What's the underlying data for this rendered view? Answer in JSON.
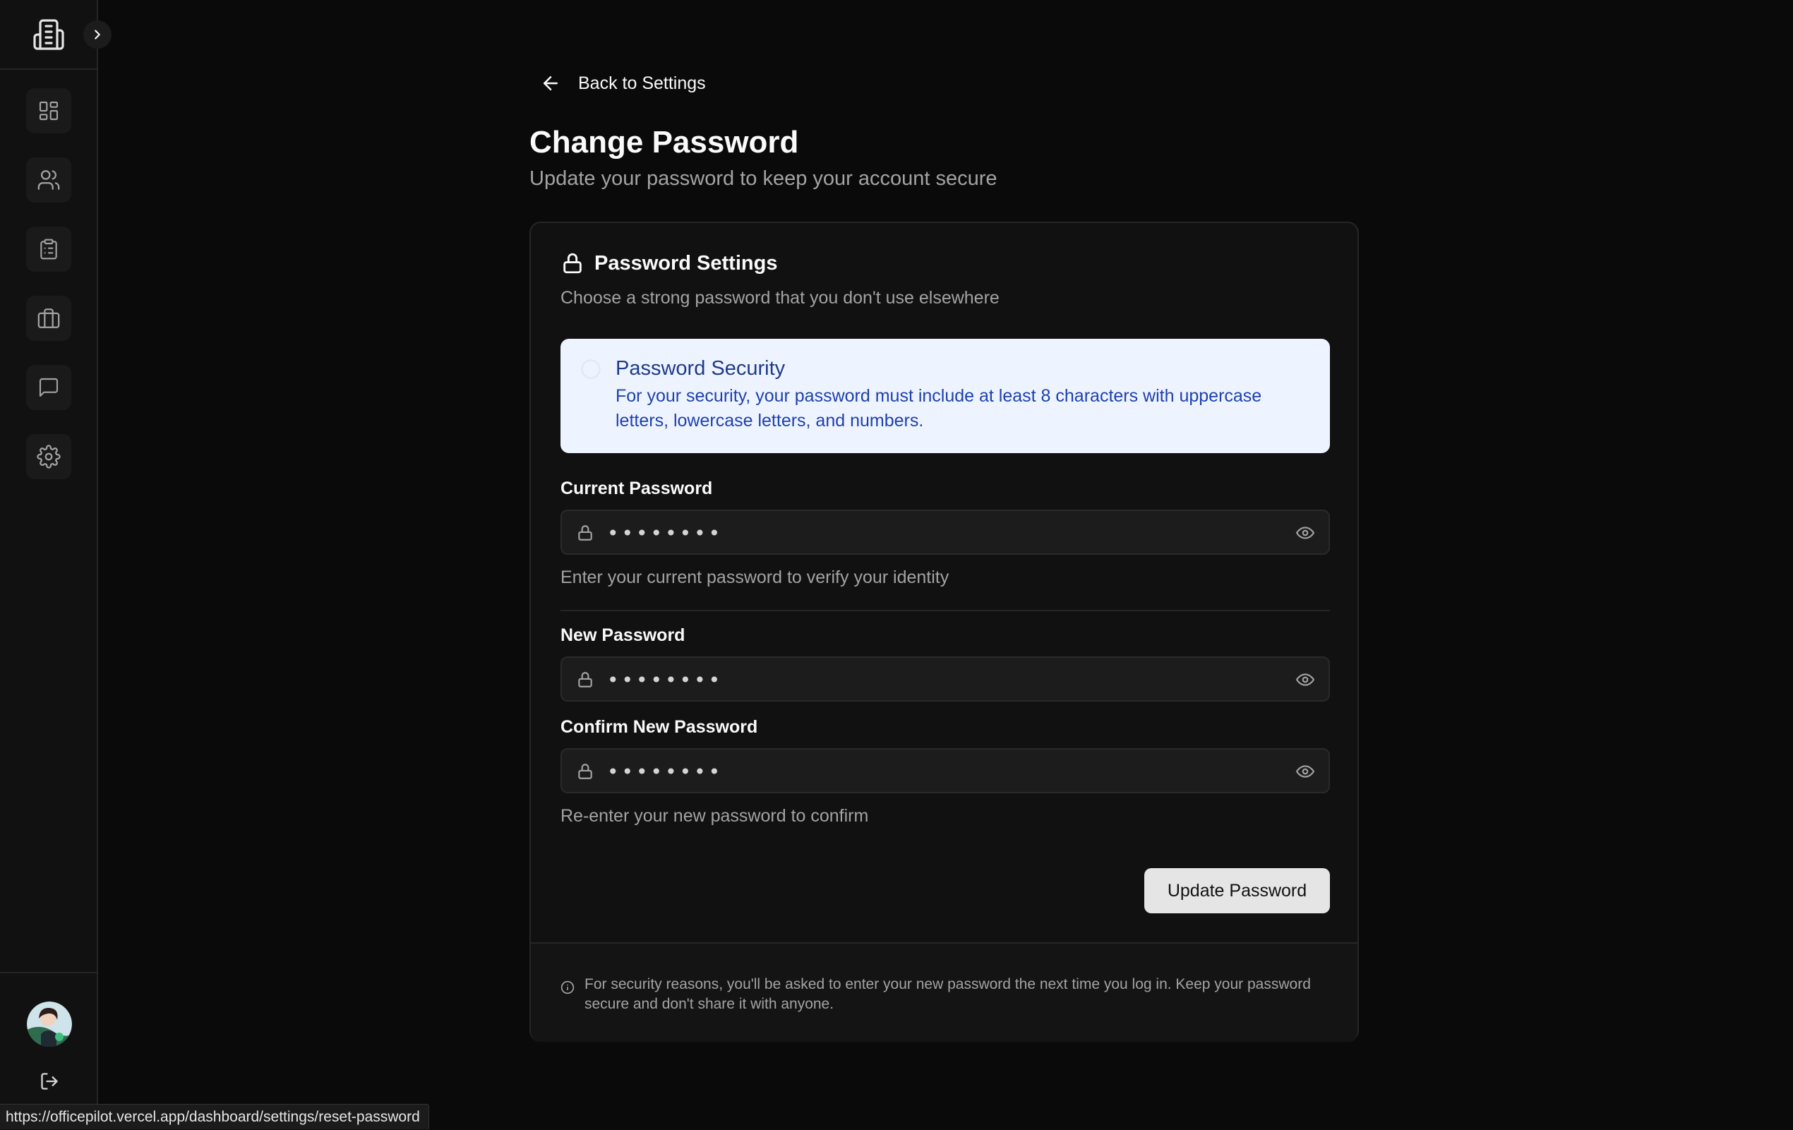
{
  "sidebar": {
    "expand_icon": "chevron-right-icon",
    "logo_icon": "building-icon",
    "nav_items": [
      {
        "name": "dashboard",
        "icon": "grid-icon"
      },
      {
        "name": "people",
        "icon": "users-icon"
      },
      {
        "name": "tasks",
        "icon": "clipboard-icon"
      },
      {
        "name": "projects",
        "icon": "briefcase-icon"
      },
      {
        "name": "messages",
        "icon": "message-icon"
      },
      {
        "name": "settings",
        "icon": "gear-icon"
      }
    ],
    "logout_icon": "logout-icon"
  },
  "back_link": {
    "label": "Back to Settings"
  },
  "page": {
    "title": "Change Password",
    "subtitle": "Update your password to keep your account secure"
  },
  "card": {
    "title": "Password Settings",
    "description": "Choose a strong password that you don't use elsewhere",
    "alert": {
      "title": "Password Security",
      "body": "For your security, your password must include at least 8 characters with uppercase letters, lowercase letters, and numbers."
    },
    "current_password": {
      "label": "Current Password",
      "value": "••••••••",
      "helper": "Enter your current password to verify your identity"
    },
    "new_password": {
      "label": "New Password",
      "value": "••••••••"
    },
    "confirm_password": {
      "label": "Confirm New Password",
      "value": "••••••••",
      "helper": "Re-enter your new password to confirm"
    },
    "submit_label": "Update Password",
    "footer_note": "For security reasons, you'll be asked to enter your new password the next time you log in. Keep your password secure and don't share it with anyone."
  },
  "status_bar": {
    "url": "https://officepilot.vercel.app/dashboard/settings/reset-password"
  },
  "colors": {
    "background": "#0a0a0a",
    "card": "#111111",
    "alert_bg": "#eef4ff",
    "alert_text": "#1e40af",
    "button_bg": "#e5e5e5"
  }
}
